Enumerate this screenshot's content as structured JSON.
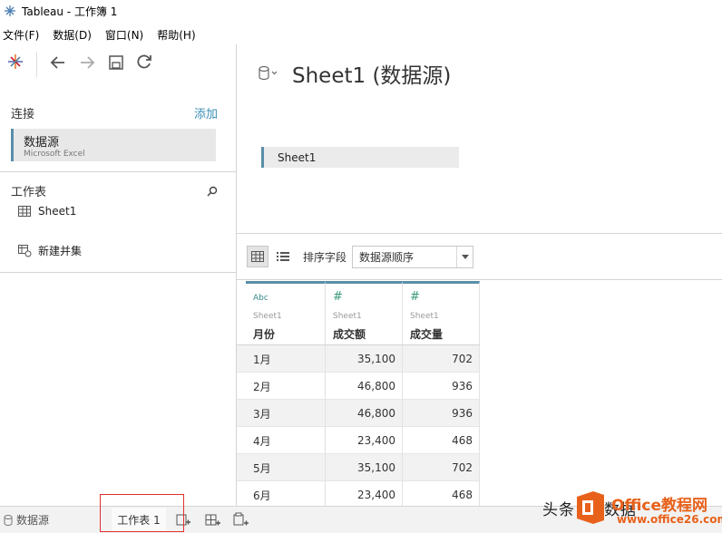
{
  "window": {
    "title": "Tableau - 工作簿 1"
  },
  "menu": [
    "文件(F)",
    "数据(D)",
    "窗口(N)",
    "帮助(H)"
  ],
  "left": {
    "connections_label": "连接",
    "add_label": "添加",
    "connection": {
      "name": "数据源",
      "type": "Microsoft Excel"
    },
    "worksheets_label": "工作表",
    "sheet": "Sheet1",
    "new_union": "新建并集"
  },
  "main": {
    "title": "Sheet1 (数据源)",
    "canvas_table": "Sheet1",
    "sort_label": "排序字段",
    "sort_value": "数据源顺序"
  },
  "grid": {
    "columns": [
      {
        "type": "Abc",
        "source": "Sheet1",
        "name": "月份"
      },
      {
        "type": "#",
        "source": "Sheet1",
        "name": "成交额"
      },
      {
        "type": "#",
        "source": "Sheet1",
        "name": "成交量"
      }
    ],
    "rows": [
      [
        "1月",
        "35,100",
        "702"
      ],
      [
        "2月",
        "46,800",
        "936"
      ],
      [
        "3月",
        "46,800",
        "936"
      ],
      [
        "4月",
        "23,400",
        "468"
      ],
      [
        "5月",
        "35,100",
        "702"
      ],
      [
        "6月",
        "23,400",
        "468"
      ]
    ]
  },
  "tabs": {
    "datasource": "数据源",
    "worksheet": "工作表 1"
  },
  "watermark": {
    "prefix": "头条",
    "mid": "数据",
    "brand": "Office教程网",
    "url": "www.office26.com"
  },
  "colors": {
    "accent": "#5a8ea8",
    "link": "#3b8fb5",
    "highlight": "#e03030",
    "watermark": "#e8611a"
  }
}
